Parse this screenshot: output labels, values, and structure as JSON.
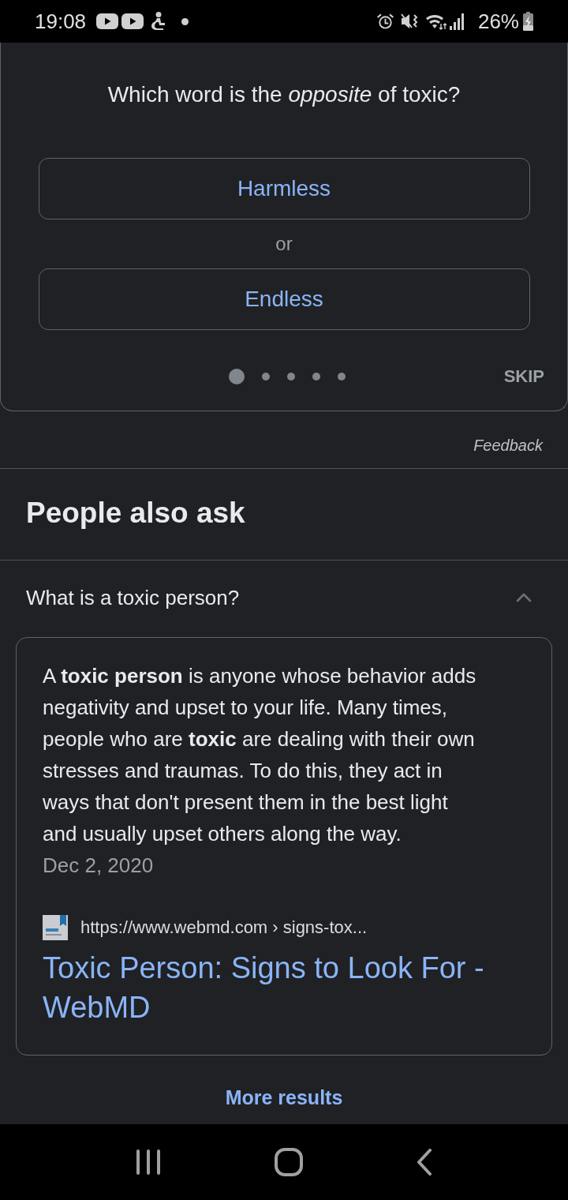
{
  "status_bar": {
    "time": "19:08",
    "battery": "26%"
  },
  "quiz": {
    "question": "Which word is the *opposite* of toxic?",
    "options": [
      {
        "label": "Harmless"
      },
      {
        "label": "Endless"
      }
    ],
    "separator": "or",
    "pages": [
      {
        "selected": true
      },
      {
        "selected": false
      },
      {
        "selected": false
      },
      {
        "selected": false
      },
      {
        "selected": false
      }
    ],
    "skip": "SKIP"
  },
  "feedback": "Feedback",
  "people_also_ask": {
    "title": "People also ask",
    "questions": [
      {
        "question": "What is a toxic person?",
        "expanded": true,
        "answer": "A **toxic person** is anyone whose behavior adds negativity and upset to your life. Many times, people who are **toxic** are dealing with their own stresses and traumas. To do this, they act in ways that don't present them in the best light and usually upset others along the way.",
        "date": "Dec 2, 2020",
        "source_url": "https://www.webmd.com › signs-tox...",
        "result_title": "Toxic Person: Signs to Look For - WebMD"
      }
    ],
    "more_results": "More results"
  }
}
